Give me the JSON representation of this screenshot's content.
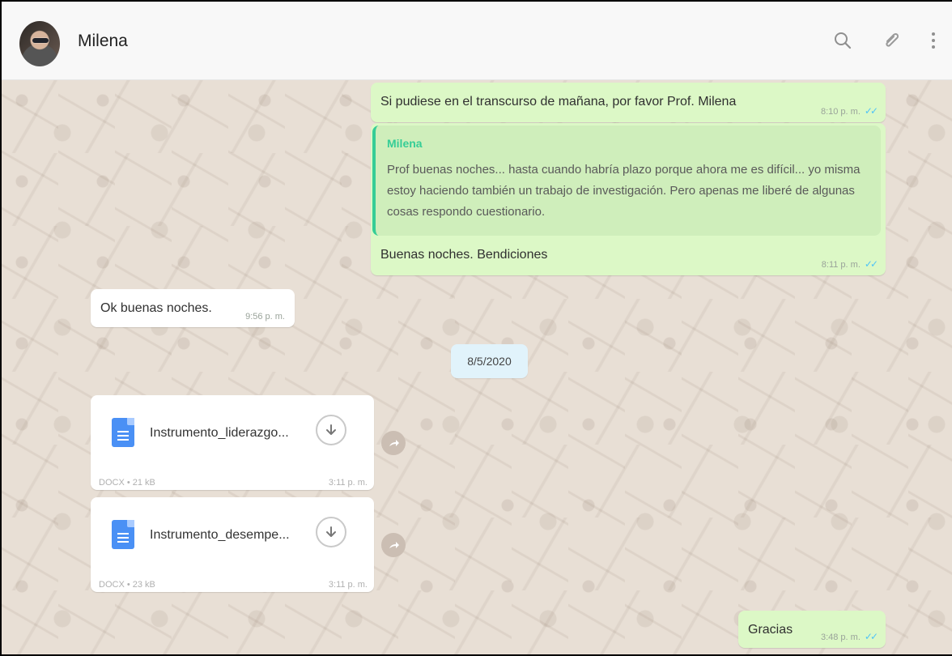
{
  "header": {
    "contact_name": "Milena",
    "icons": [
      "search-icon",
      "paperclip-icon",
      "more-vertical-icon"
    ]
  },
  "messages": [
    {
      "type": "outgoing",
      "text": "Si pudiese en el transcurso de mañana, por favor Prof. Milena",
      "time": "8:10 p. m."
    },
    {
      "type": "outgoing_reply",
      "quoted_name": "Milena",
      "quoted_text": "Prof buenas noches... hasta cuando habría plazo porque ahora me es difícil... yo misma estoy haciendo también un trabajo de investigación.  Pero apenas me liberé de algunas cosas respondo cuestionario.",
      "text": "Buenas noches. Bendiciones",
      "time": "8:11 p. m."
    },
    {
      "type": "incoming",
      "text": "Ok buenas noches.",
      "time": "9:56 p. m."
    },
    {
      "type": "date",
      "text": "8/5/2020"
    },
    {
      "type": "incoming_document",
      "file_name": "Instrumento_liderazgo...",
      "file_meta": "DOCX • 21 kB",
      "time": "3:11 p. m."
    },
    {
      "type": "incoming_document",
      "file_name": "Instrumento_desempe...",
      "file_meta": "DOCX • 23 kB",
      "time": "3:11 p. m."
    },
    {
      "type": "outgoing",
      "text": "Gracias",
      "time": "3:48 p. m."
    }
  ],
  "read_receipt": "✓✓",
  "colors": {
    "outgoing": "#dcf8c6",
    "incoming": "#ffffff",
    "chat_background": "#e8dfd5",
    "date_chip": "#e1f3fb",
    "accent": "#35cd96",
    "read_ticks": "#4fc3f7",
    "document": "#4a90f5"
  }
}
